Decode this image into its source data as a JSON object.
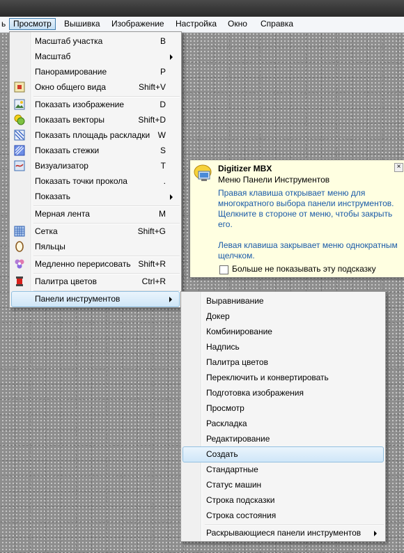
{
  "menubar": {
    "partial": "ь",
    "items": [
      "Просмотр",
      "Вышивка",
      "Изображение",
      "Настройка",
      "Окно",
      "Справка"
    ]
  },
  "view_menu": {
    "items": [
      {
        "label": "Масштаб участка",
        "shortcut": "B"
      },
      {
        "label": "Масштаб",
        "shortcut": ""
      },
      {
        "label": "Панорамирование",
        "shortcut": "P"
      },
      {
        "label": "Окно общего вида",
        "shortcut": "Shift+V"
      },
      {
        "label": "Показать изображение",
        "shortcut": "D"
      },
      {
        "label": "Показать векторы",
        "shortcut": "Shift+D"
      },
      {
        "label": "Показать площадь раскладки",
        "shortcut": "W"
      },
      {
        "label": "Показать стежки",
        "shortcut": "S"
      },
      {
        "label": "Визуализатор",
        "shortcut": "T"
      },
      {
        "label": "Показать точки прокола",
        "shortcut": "."
      },
      {
        "label": "Показать",
        "shortcut": ""
      },
      {
        "label": "Мерная лента",
        "shortcut": "M"
      },
      {
        "label": "Сетка",
        "shortcut": "Shift+G"
      },
      {
        "label": "Пяльцы",
        "shortcut": ""
      },
      {
        "label": "Медленно перерисовать",
        "shortcut": "Shift+R"
      },
      {
        "label": "Палитра цветов",
        "shortcut": "Ctrl+R"
      },
      {
        "label": "Панели инструментов",
        "shortcut": ""
      }
    ]
  },
  "toolbars_menu": {
    "items": [
      "Выравнивание",
      "Докер",
      "Комбинирование",
      "Надпись",
      "Палитра цветов",
      "Переключить и конвертировать",
      "Подготовка изображения",
      "Просмотр",
      "Раскладка",
      "Редактирование",
      "Создать",
      "Стандартные",
      "Статус машин",
      "Строка подсказки",
      "Строка состояния",
      "Раскрывающиеся панели инструментов"
    ]
  },
  "tooltip": {
    "title": "Digitizer MBX",
    "subtitle": "Меню Панели Инструментов",
    "line1": "Правая клавиша открывает меню для",
    "line2": "многократного выбора панели инструментов.",
    "line3": "Щелкните в стороне от меню, чтобы закрыть",
    "line4": "его.",
    "line5": "Левая клавиша закрывает меню однократным",
    "line6": "щелчком.",
    "checkbox_label": "Больше не показывать эту подсказку"
  }
}
